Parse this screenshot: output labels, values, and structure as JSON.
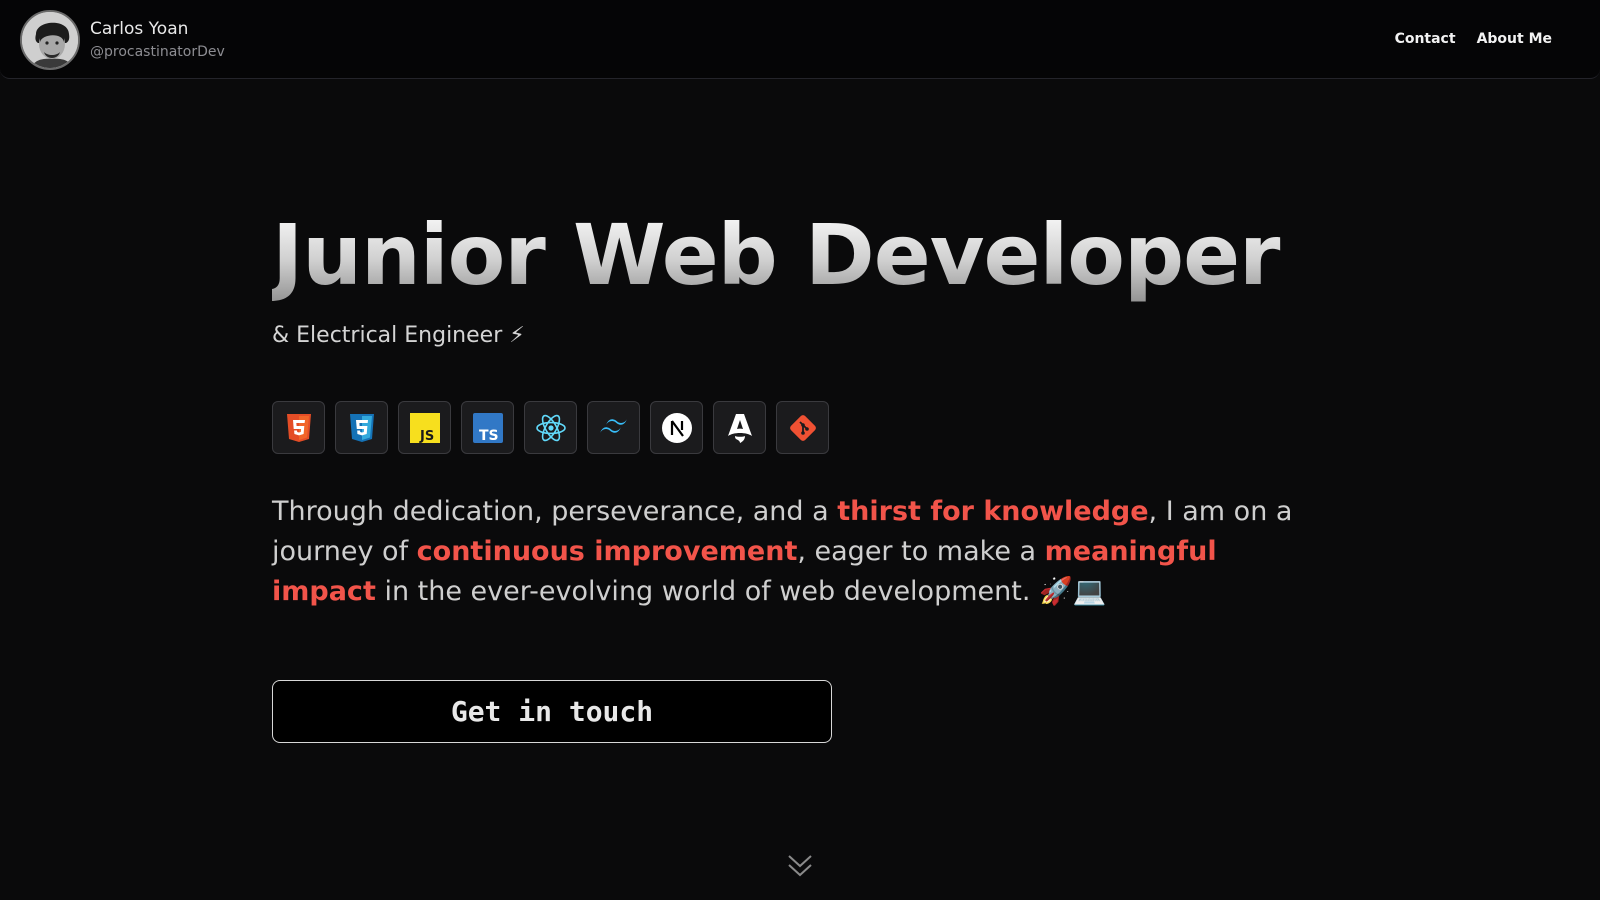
{
  "header": {
    "name": "Carlos Yoan",
    "handle": "@procastinatorDev",
    "nav": {
      "contact": "Contact",
      "about": "About Me"
    }
  },
  "hero": {
    "title": "Junior Web Developer",
    "subtitle": "& Electrical Engineer ⚡",
    "tech_icons": [
      "html5-icon",
      "css3-icon",
      "javascript-icon",
      "typescript-icon",
      "react-icon",
      "tailwind-icon",
      "nextjs-icon",
      "astro-icon",
      "git-icon"
    ],
    "pitch": {
      "p1": "Through dedication, perseverance, and a ",
      "h1": "thirst for knowledge",
      "p2": ", I am on a journey of ",
      "h2": "continuous improvement",
      "p3": ", eager to make a ",
      "h3": "meaningful impact",
      "p4": " in the ever-evolving world of web development. 🚀💻"
    },
    "cta": "Get in touch"
  },
  "colors": {
    "background": "#0a0a0b",
    "accent": "#f2544a",
    "text": "#cfcfcf"
  }
}
